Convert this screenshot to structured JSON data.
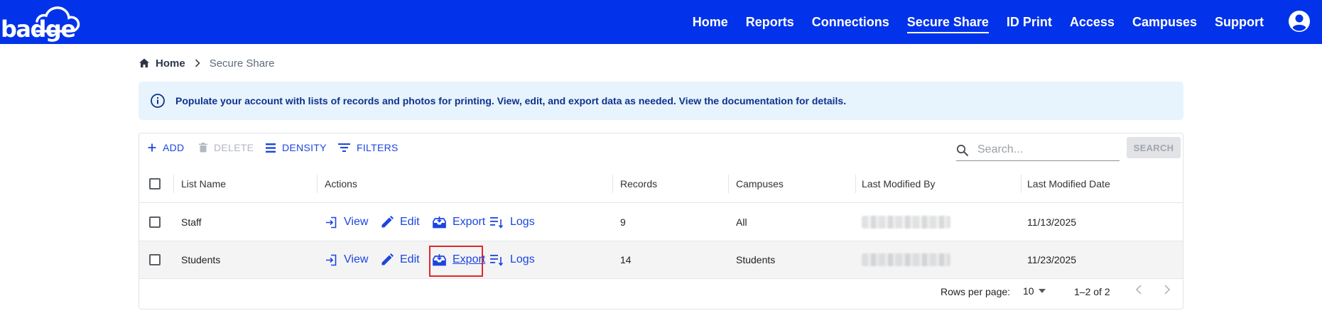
{
  "brand": {
    "logo_text": "badge"
  },
  "colors": {
    "nav_bg": "#0233ea",
    "accent": "#1b45e0",
    "banner_bg": "#e7f4fd",
    "highlight": "#e0282a"
  },
  "nav": {
    "items": [
      {
        "label": "Home",
        "active": false
      },
      {
        "label": "Reports",
        "active": false
      },
      {
        "label": "Connections",
        "active": false
      },
      {
        "label": "Secure Share",
        "active": true
      },
      {
        "label": "ID Print",
        "active": false
      },
      {
        "label": "Access",
        "active": false
      },
      {
        "label": "Campuses",
        "active": false
      },
      {
        "label": "Support",
        "active": false
      }
    ],
    "account_icon": "account-circle-icon"
  },
  "breadcrumb": {
    "home": "Home",
    "current": "Secure Share"
  },
  "banner": {
    "icon": "info-icon",
    "text": "Populate your account with lists of records and photos for printing. View, edit, and export data as needed. View the documentation for details."
  },
  "toolbar": {
    "add": "ADD",
    "delete": "DELETE",
    "density": "DENSITY",
    "filters": "FILTERS",
    "search_placeholder": "Search...",
    "search_button": "SEARCH"
  },
  "table": {
    "columns": [
      "List Name",
      "Actions",
      "Records",
      "Campuses",
      "Last Modified By",
      "Last Modified Date"
    ],
    "action_labels": {
      "view": "View",
      "edit": "Edit",
      "export": "Export",
      "logs": "Logs"
    },
    "rows": [
      {
        "list_name": "Staff",
        "records": "9",
        "campuses": "All",
        "last_modified_date": "11/13/2025"
      },
      {
        "list_name": "Students",
        "records": "14",
        "campuses": "Students",
        "last_modified_date": "11/23/2025"
      }
    ]
  },
  "footer": {
    "rows_per_page_label": "Rows per page:",
    "rows_per_page": "10",
    "range": "1–2 of 2"
  }
}
